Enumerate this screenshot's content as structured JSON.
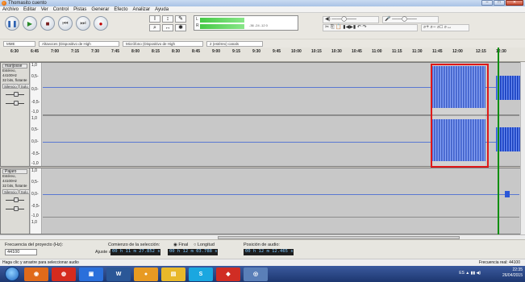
{
  "window": {
    "title": "Thomasito cuento"
  },
  "menu": [
    "Archivo",
    "Editar",
    "Ver",
    "Control",
    "Pistas",
    "Generar",
    "Efecto",
    "Analizar",
    "Ayuda"
  ],
  "transport": {
    "pause": "❚❚",
    "play": "▶",
    "stop": "■",
    "skip_start": "⏮",
    "skip_end": "⏭",
    "record": "●"
  },
  "tools": [
    "I",
    "↕",
    "✎",
    "⌕",
    "↔",
    "✱"
  ],
  "meter": {
    "left_label": "L",
    "right_label": "R",
    "scale": "-36  -24  -12  0"
  },
  "device": {
    "host": "MME",
    "output": "Altavoces (Dispositivo de High",
    "input": "Micrófono (Dispositivo de High",
    "channels": "2 (estéreo) canals"
  },
  "ruler": {
    "ticks": [
      "6:30",
      "6:45",
      "7:00",
      "7:15",
      "7:30",
      "7:45",
      "8:00",
      "8:15",
      "8:30",
      "8:45",
      "9:00",
      "9:15",
      "9:30",
      "9:45",
      "10:00",
      "10:15",
      "10:30",
      "10:45",
      "11:00",
      "11:15",
      "11:30",
      "11:45",
      "12:00",
      "12:15",
      "12:30"
    ]
  },
  "tracks": [
    {
      "name": "marijosse",
      "info": "Estéreo, 44100Hz",
      "bits": "32 bits, flotante",
      "silence": "Silencio",
      "solo": "Solo",
      "scale": [
        "1,0",
        "0,5-",
        "0,0-",
        "-0,5-",
        "-1,0"
      ]
    },
    {
      "name": "Pajaro",
      "info": "Estéreo, 44100Hz",
      "bits": "32 bits, flotante",
      "silence": "Silencio",
      "solo": "Solo",
      "scale": [
        "1,0",
        "0,5-",
        "0,0-",
        "-0,5-",
        "-1,0"
      ]
    }
  ],
  "selection_bar": {
    "project_rate_label": "Frecuencia del proyecto (Hz):",
    "project_rate": "44100",
    "snap_label": "Ajuste a",
    "start_label": "Comienzo de la selección:",
    "final_label": "Final",
    "length_label": "Longitud",
    "start_time": "00 h 11 m 27.852 s",
    "end_time": "00 h 12 m 03.788 s",
    "audio_position_label": "Posición de audio:",
    "audio_position": "00 h 12 m 12.465 s"
  },
  "status": {
    "hint": "Haga clic y arrastre para seleccionar audio",
    "real_rate": "Frecuencia real: 44100"
  },
  "taskbar": {
    "lang": "ES",
    "time": "22:35",
    "date": "26/04/2015"
  }
}
